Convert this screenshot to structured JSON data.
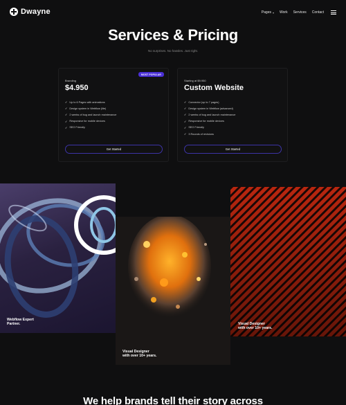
{
  "brand": {
    "name": "Dwayne",
    "icon": "plus-circle-icon"
  },
  "nav": {
    "links": [
      {
        "label": "Pages",
        "dropdown": true
      },
      {
        "label": "Work"
      },
      {
        "label": "Services"
      },
      {
        "label": "Contact"
      }
    ],
    "menu_icon": "hamburger-icon"
  },
  "hero": {
    "title": "Services & Pricing",
    "subtitle": "No surprises. No hassles. Just right."
  },
  "plans": [
    {
      "eyebrow": "Branding",
      "price": "$4.950",
      "badge": "MOST POPULAR",
      "features": [
        "Up to 6 Pages with animations",
        "Design system in Webflow (lite)",
        "2 weeks of bug and launch maintenance",
        "Responsive for mobile devices",
        "SEO Friendly"
      ],
      "cta": "Get Started"
    },
    {
      "eyebrow": "Starting at $9.950",
      "price": "Custom Website",
      "features": [
        "Connector (up to 7 pages)",
        "Design system in Webflow (advanced)",
        "2 weeks of bug and launch maintenance",
        "Responsive for mobile devices",
        "SEO Friendly",
        "3 Rounds of revisions"
      ],
      "cta": "Get Started"
    }
  ],
  "gallery": [
    {
      "caption": "Webflow Expert\nPartner."
    },
    {
      "caption": "Visual Designer\nwith over 10+ years."
    },
    {
      "caption": "Visual Designer\nwith over 10+ years."
    }
  ],
  "bottom_heading": "We help brands tell their story across",
  "colors": {
    "background": "#0f0f10",
    "accent": "#4a2fd6",
    "cta_border": "#3d34a8"
  }
}
